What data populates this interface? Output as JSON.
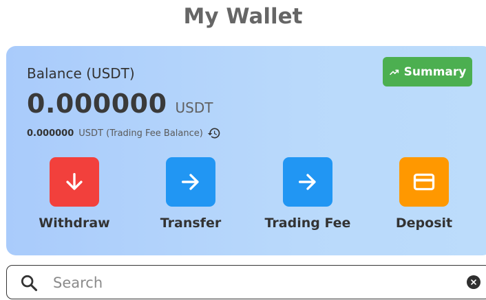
{
  "header": {
    "title": "My Wallet"
  },
  "balance": {
    "label": "Balance (USDT)",
    "amount": "0.000000",
    "unit": "USDT",
    "fee_amount": "0.000000",
    "fee_label": "USDT (Trading Fee Balance)"
  },
  "summary_button": {
    "label": "Summary",
    "icon": "trending-up-icon"
  },
  "actions": [
    {
      "label": "Withdraw",
      "icon": "arrow-down-icon",
      "color": "#f2403c"
    },
    {
      "label": "Transfer",
      "icon": "arrow-right-icon",
      "color": "#2196f3"
    },
    {
      "label": "Trading Fee",
      "icon": "arrow-right-icon",
      "color": "#2196f3"
    },
    {
      "label": "Deposit",
      "icon": "card-icon",
      "color": "#ff9800"
    }
  ],
  "search": {
    "placeholder": "Search",
    "value": ""
  },
  "colors": {
    "summary": "#4caf50",
    "withdraw": "#f2403c",
    "transfer": "#2196f3",
    "deposit": "#ff9800"
  }
}
